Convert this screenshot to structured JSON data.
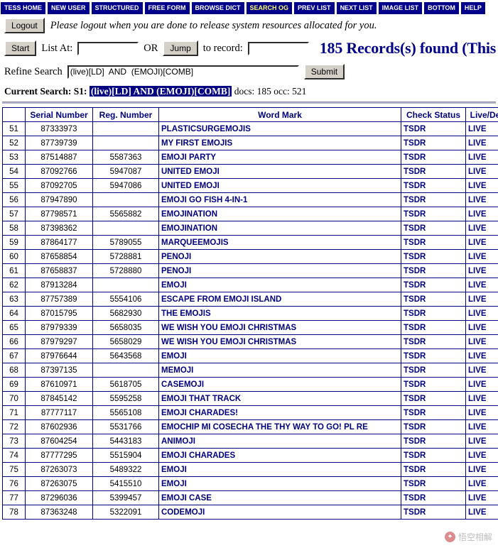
{
  "navbar": {
    "items": [
      {
        "label": "TESS Home",
        "selected": false
      },
      {
        "label": "New User",
        "selected": false
      },
      {
        "label": "Structured",
        "selected": false
      },
      {
        "label": "Free Form",
        "selected": false
      },
      {
        "label": "Browse Dict",
        "selected": false
      },
      {
        "label": "Search OG",
        "selected": true
      },
      {
        "label": "Prev List",
        "selected": false
      },
      {
        "label": "Next List",
        "selected": false
      },
      {
        "label": "Image List",
        "selected": false
      },
      {
        "label": "Bottom",
        "selected": false
      },
      {
        "label": "Help",
        "selected": false
      }
    ]
  },
  "logout": {
    "button_label": "Logout",
    "note": "Please logout when you are done to release system resources allocated for you."
  },
  "controls": {
    "start_label": "Start",
    "list_at_label": "List At:",
    "list_at_value": "",
    "or_label": "OR",
    "jump_label": "Jump",
    "to_record_label": "to record:",
    "to_record_value": "",
    "records_found": "185 Records(s) found (This"
  },
  "refine": {
    "label": "Refine Search",
    "value": "(live)[LD]  AND  (EMOJI)[COMB]",
    "submit_label": "Submit"
  },
  "current_search": {
    "prefix": "Current Search: S1:",
    "query": "(live)[LD] AND (EMOJI)[COMB]",
    "suffix": "docs: 185 occ: 521"
  },
  "table": {
    "headers": [
      "",
      "Serial Number",
      "Reg. Number",
      "Word Mark",
      "Check Status",
      "Live/Dead"
    ],
    "rows": [
      {
        "num": "51",
        "serial": "87333973",
        "reg": "",
        "mark": "PLASTICSURGEMOJIS",
        "check": "TSDR",
        "live": "LIVE"
      },
      {
        "num": "52",
        "serial": "87739739",
        "reg": "",
        "mark": "MY FIRST EMOJIS",
        "check": "TSDR",
        "live": "LIVE"
      },
      {
        "num": "53",
        "serial": "87514887",
        "reg": "5587363",
        "mark": "EMOJI PARTY",
        "check": "TSDR",
        "live": "LIVE"
      },
      {
        "num": "54",
        "serial": "87092766",
        "reg": "5947087",
        "mark": "UNITED EMOJI",
        "check": "TSDR",
        "live": "LIVE"
      },
      {
        "num": "55",
        "serial": "87092705",
        "reg": "5947086",
        "mark": "UNITED EMOJI",
        "check": "TSDR",
        "live": "LIVE"
      },
      {
        "num": "56",
        "serial": "87947890",
        "reg": "",
        "mark": "EMOJI GO FISH 4-IN-1",
        "check": "TSDR",
        "live": "LIVE"
      },
      {
        "num": "57",
        "serial": "87798571",
        "reg": "5565882",
        "mark": "EMOJINATION",
        "check": "TSDR",
        "live": "LIVE"
      },
      {
        "num": "58",
        "serial": "87398362",
        "reg": "",
        "mark": "EMOJINATION",
        "check": "TSDR",
        "live": "LIVE"
      },
      {
        "num": "59",
        "serial": "87864177",
        "reg": "5789055",
        "mark": "MARQUEEMOJIS",
        "check": "TSDR",
        "live": "LIVE"
      },
      {
        "num": "60",
        "serial": "87658854",
        "reg": "5728881",
        "mark": "PENOJI",
        "check": "TSDR",
        "live": "LIVE"
      },
      {
        "num": "61",
        "serial": "87658837",
        "reg": "5728880",
        "mark": "PENOJI",
        "check": "TSDR",
        "live": "LIVE"
      },
      {
        "num": "62",
        "serial": "87913284",
        "reg": "",
        "mark": "EMOJI",
        "check": "TSDR",
        "live": "LIVE"
      },
      {
        "num": "63",
        "serial": "87757389",
        "reg": "5554106",
        "mark": "ESCAPE FROM EMOJI ISLAND",
        "check": "TSDR",
        "live": "LIVE"
      },
      {
        "num": "64",
        "serial": "87015795",
        "reg": "5682930",
        "mark": "THE EMOJIS",
        "check": "TSDR",
        "live": "LIVE"
      },
      {
        "num": "65",
        "serial": "87979339",
        "reg": "5658035",
        "mark": "WE WISH YOU EMOJI CHRISTMAS",
        "check": "TSDR",
        "live": "LIVE"
      },
      {
        "num": "66",
        "serial": "87979297",
        "reg": "5658029",
        "mark": "WE WISH YOU EMOJI CHRISTMAS",
        "check": "TSDR",
        "live": "LIVE"
      },
      {
        "num": "67",
        "serial": "87976644",
        "reg": "5643568",
        "mark": "EMOJI",
        "check": "TSDR",
        "live": "LIVE"
      },
      {
        "num": "68",
        "serial": "87397135",
        "reg": "",
        "mark": "MEMOJI",
        "check": "TSDR",
        "live": "LIVE"
      },
      {
        "num": "69",
        "serial": "87610971",
        "reg": "5618705",
        "mark": "CASEMOJI",
        "check": "TSDR",
        "live": "LIVE"
      },
      {
        "num": "70",
        "serial": "87845142",
        "reg": "5595258",
        "mark": "EMOJI THAT TRACK",
        "check": "TSDR",
        "live": "LIVE"
      },
      {
        "num": "71",
        "serial": "87777117",
        "reg": "5565108",
        "mark": "EMOJI CHARADES!",
        "check": "TSDR",
        "live": "LIVE"
      },
      {
        "num": "72",
        "serial": "87602936",
        "reg": "5531766",
        "mark": "EMOCHIP MI COSECHA THE THY WAY TO GO! PL RE",
        "check": "TSDR",
        "live": "LIVE"
      },
      {
        "num": "73",
        "serial": "87604254",
        "reg": "5443183",
        "mark": "ANIMOJI",
        "check": "TSDR",
        "live": "LIVE"
      },
      {
        "num": "74",
        "serial": "87777295",
        "reg": "5515904",
        "mark": "EMOJI CHARADES",
        "check": "TSDR",
        "live": "LIVE"
      },
      {
        "num": "75",
        "serial": "87263073",
        "reg": "5489322",
        "mark": "EMOJI",
        "check": "TSDR",
        "live": "LIVE"
      },
      {
        "num": "76",
        "serial": "87263075",
        "reg": "5415510",
        "mark": "EMOJI",
        "check": "TSDR",
        "live": "LIVE"
      },
      {
        "num": "77",
        "serial": "87296036",
        "reg": "5399457",
        "mark": "EMOJI CASE",
        "check": "TSDR",
        "live": "LIVE"
      },
      {
        "num": "78",
        "serial": "87363248",
        "reg": "5322091",
        "mark": "CODEMOJI",
        "check": "TSDR",
        "live": "LIVE"
      }
    ]
  },
  "watermark": {
    "text": "悟空相解"
  }
}
